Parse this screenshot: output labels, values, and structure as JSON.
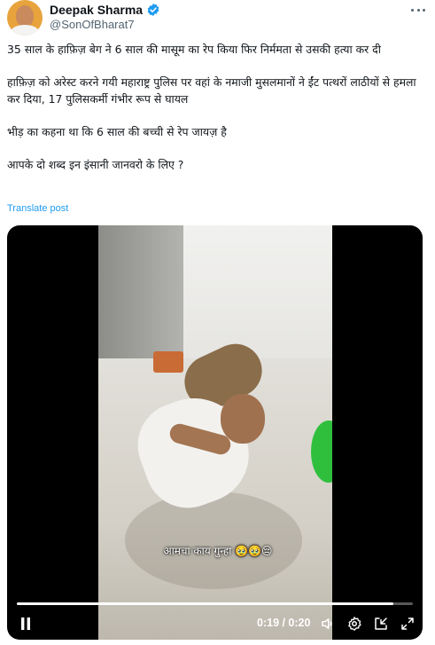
{
  "author": {
    "display_name": "Deepak Sharma",
    "handle": "@SonOfBharat7",
    "verified_icon": "verified-badge-icon",
    "verified_color": "#1d9bf0"
  },
  "tweet": {
    "paragraphs": [
      "35 साल के हाफ़िज़ बेग ने 6 साल की मासूम का रेप किया फिर निर्ममता से उसकी हत्या कर दी",
      "हाफ़िज़ को अरेस्ट करने गयी महाराष्ट्र पुलिस पर वहां के नमाजी मुसलमानों ने ईंट पत्थरों लाठीयों से हमला कर दिया, 17 पुलिसकर्मी गंभीर रूप से घायल",
      "भीड़ का कहना था कि 6 साल की बच्ची से रेप जायज़ है",
      "आपके दो शब्द इन इंसानी जानवरो के लिए ?"
    ],
    "translate_label": "Translate post",
    "link_color": "#1d9bf0"
  },
  "video": {
    "caption": "आमचा काय गुन्हा 🥹🥹😔",
    "time_display": "0:19 / 0:20",
    "progress": 0.95,
    "icons": [
      "pause-icon",
      "volume-icon",
      "settings-icon",
      "picture-in-picture-icon",
      "fullscreen-icon"
    ]
  }
}
